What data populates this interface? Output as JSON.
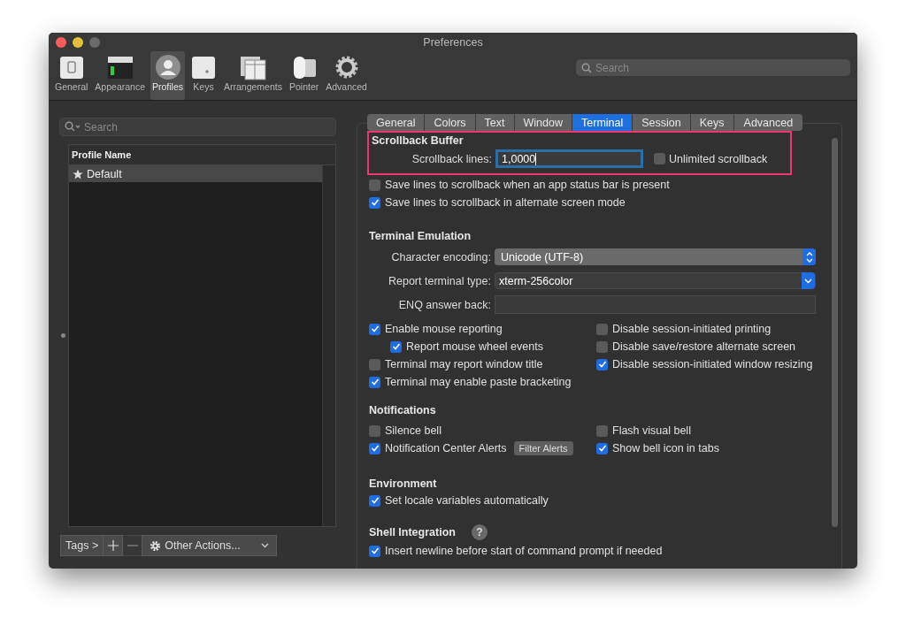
{
  "window": {
    "title": "Preferences"
  },
  "toolbar": [
    {
      "label": "General",
      "selected": false
    },
    {
      "label": "Appearance",
      "selected": false
    },
    {
      "label": "Profiles",
      "selected": true
    },
    {
      "label": "Keys",
      "selected": false
    },
    {
      "label": "Arrangements",
      "selected": false
    },
    {
      "label": "Pointer",
      "selected": false
    },
    {
      "label": "Advanced",
      "selected": false
    }
  ],
  "toolbar_search": {
    "placeholder": "Search"
  },
  "profiles": {
    "search": {
      "placeholder": "Search"
    },
    "column": "Profile Name",
    "rows": [
      {
        "name": "Default",
        "selected": true
      }
    ],
    "tags_button": "Tags >",
    "remove_disabled": true,
    "actions_button": "Other Actions..."
  },
  "tabs": [
    {
      "label": "General",
      "selected": false
    },
    {
      "label": "Colors",
      "selected": false
    },
    {
      "label": "Text",
      "selected": false
    },
    {
      "label": "Window",
      "selected": false
    },
    {
      "label": "Terminal",
      "selected": true
    },
    {
      "label": "Session",
      "selected": false
    },
    {
      "label": "Keys",
      "selected": false
    },
    {
      "label": "Advanced",
      "selected": false
    }
  ],
  "scrollback": {
    "title": "Scrollback Buffer",
    "highlighted": true,
    "lines_label": "Scrollback lines:",
    "lines_value": "1,0000",
    "focused": true,
    "unlimited": {
      "label": "Unlimited scrollback",
      "checked": false
    },
    "options": [
      {
        "label": "Save lines to scrollback when an app status bar is present",
        "checked": false
      },
      {
        "label": "Save lines to scrollback in alternate screen mode",
        "checked": true
      }
    ]
  },
  "emulation": {
    "title": "Terminal Emulation",
    "fields": [
      {
        "kind": "popup",
        "label": "Character encoding:",
        "value": "Unicode (UTF-8)"
      },
      {
        "kind": "pulldown",
        "label": "Report terminal type:",
        "value": "xterm-256color"
      },
      {
        "kind": "text",
        "label": "ENQ answer back:"
      }
    ],
    "left": [
      {
        "label": "Enable mouse reporting",
        "checked": true,
        "children": [
          {
            "label": "Report mouse wheel events",
            "checked": true
          }
        ]
      },
      {
        "label": "Terminal may report window title",
        "checked": false
      },
      {
        "label": "Terminal may enable paste bracketing",
        "checked": true
      }
    ],
    "right": [
      {
        "label": "Disable session-initiated printing",
        "checked": false
      },
      {
        "label": "Disable save/restore alternate screen",
        "checked": false
      },
      {
        "label": "Disable session-initiated window resizing",
        "checked": true
      }
    ]
  },
  "notifications": {
    "title": "Notifications",
    "left": [
      {
        "label": "Silence bell",
        "checked": false
      },
      {
        "label": "Notification Center Alerts",
        "checked": true,
        "button": "Filter Alerts"
      }
    ],
    "right": [
      {
        "label": "Flash visual bell",
        "checked": false
      },
      {
        "label": "Show bell icon in tabs",
        "checked": true
      }
    ]
  },
  "environment": {
    "title": "Environment",
    "options": [
      {
        "label": "Set locale variables automatically",
        "checked": true
      }
    ]
  },
  "shell_integration": {
    "title": "Shell Integration",
    "help": "?",
    "options": [
      {
        "label": "Insert newline before start of command prompt if needed",
        "checked": true
      }
    ]
  }
}
